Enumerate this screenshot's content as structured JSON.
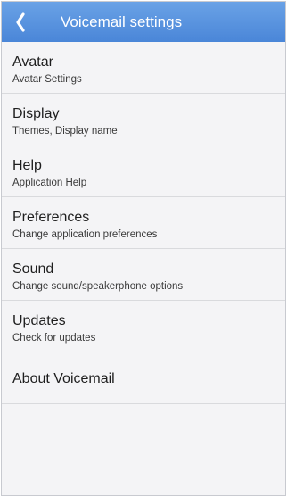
{
  "header": {
    "title": "Voicemail settings",
    "back_icon": "chevron-left-icon"
  },
  "colors": {
    "action_bar": "#4a86d8",
    "background": "#f4f4f6"
  },
  "menu": {
    "items": [
      {
        "title": "Avatar",
        "subtitle": "Avatar Settings"
      },
      {
        "title": "Display",
        "subtitle": "Themes, Display name"
      },
      {
        "title": "Help",
        "subtitle": "Application Help"
      },
      {
        "title": "Preferences",
        "subtitle": "Change application preferences"
      },
      {
        "title": "Sound",
        "subtitle": "Change sound/speakerphone options"
      },
      {
        "title": "Updates",
        "subtitle": "Check for updates"
      },
      {
        "title": "About Voicemail"
      }
    ]
  }
}
